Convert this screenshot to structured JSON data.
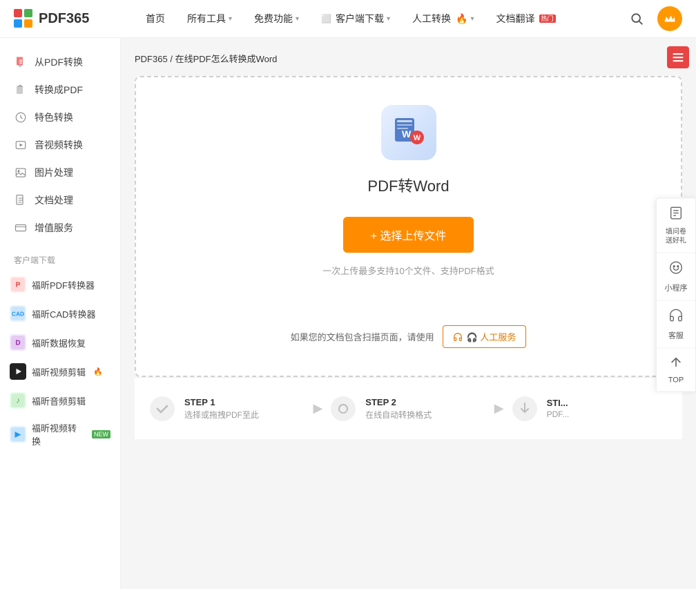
{
  "nav": {
    "logo_text": "PDF365",
    "items": [
      {
        "label": "首页",
        "has_arrow": false
      },
      {
        "label": "所有工具",
        "has_arrow": true
      },
      {
        "label": "免费功能",
        "has_arrow": true
      },
      {
        "label": "客户端下载",
        "has_arrow": true,
        "has_download_icon": true
      },
      {
        "label": "人工转换",
        "has_arrow": true,
        "has_fire": true
      },
      {
        "label": "文档翻译",
        "has_arrow": false,
        "has_hot": true
      }
    ]
  },
  "sidebar": {
    "items": [
      {
        "label": "从PDF转换",
        "icon": "pdf-from"
      },
      {
        "label": "转换成PDF",
        "icon": "pdf-to"
      },
      {
        "label": "特色转换",
        "icon": "special"
      },
      {
        "label": "音视频转换",
        "icon": "media"
      },
      {
        "label": "图片处理",
        "icon": "image"
      },
      {
        "label": "文档处理",
        "icon": "doc"
      },
      {
        "label": "增值服务",
        "icon": "value"
      }
    ],
    "download_section": "客户端下载",
    "download_items": [
      {
        "label": "福昕PDF转换器",
        "icon_color": "#e84444",
        "icon_char": "🔴"
      },
      {
        "label": "福昕CAD转换器",
        "icon_color": "#2196f3",
        "icon_char": "🔵"
      },
      {
        "label": "福昕数据恢复",
        "icon_color": "#9c27b0",
        "icon_char": "🟣"
      },
      {
        "label": "福昕视频剪辑",
        "icon_color": "#1a1a1a",
        "icon_char": "⚫",
        "has_fire": true
      },
      {
        "label": "福昕音频剪辑",
        "icon_color": "#4caf50",
        "icon_char": "🟢"
      },
      {
        "label": "福昕视频转换",
        "icon_color": "#2196f3",
        "icon_char": "🔵",
        "has_new": true
      }
    ]
  },
  "breadcrumb": {
    "home": "PDF365",
    "separator": " / ",
    "current": "在线PDF怎么转换成Word"
  },
  "tool": {
    "name": "PDF转Word",
    "upload_btn": "+ 选择上传文件",
    "hint": "一次上传最多支持10个文件、支持PDF格式",
    "manual_hint": "如果您的文档包含扫描页面，请使用",
    "manual_btn": "🎧 人工服务"
  },
  "steps": [
    {
      "label": "STEP 1",
      "desc": "选择或拖拽PDF至此",
      "icon": "✔"
    },
    {
      "label": "STEP 2",
      "desc": "在线自动转换格式",
      "icon": "🔄"
    },
    {
      "label": "STI...",
      "desc": "PDF...",
      "icon": "⬇"
    }
  ],
  "right_float": [
    {
      "label": "填问卷\n送好礼",
      "icon": "📋"
    },
    {
      "label": "小程序",
      "icon": "⊕"
    },
    {
      "label": "客服",
      "icon": "🎧"
    },
    {
      "label": "TOP",
      "icon": "▲"
    }
  ]
}
